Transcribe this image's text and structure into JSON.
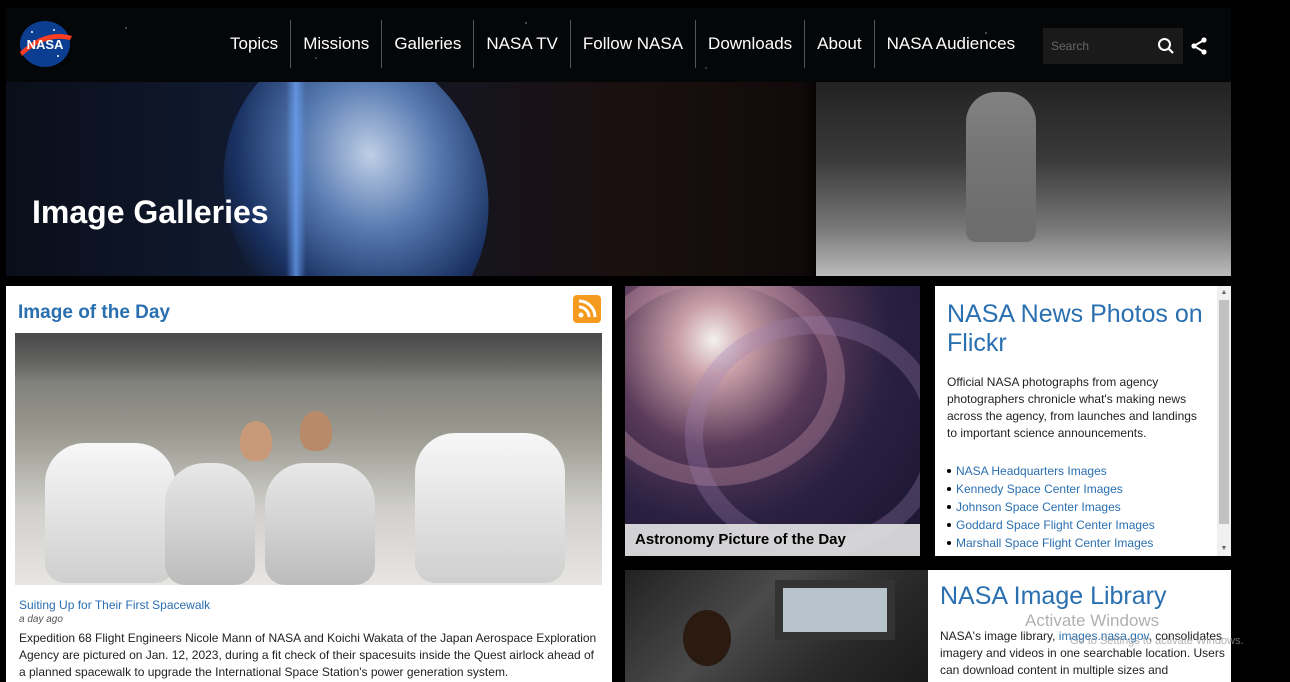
{
  "nav": {
    "items": [
      "Topics",
      "Missions",
      "Galleries",
      "NASA TV",
      "Follow NASA",
      "Downloads",
      "About",
      "NASA Audiences"
    ],
    "search_placeholder": "Search"
  },
  "hero": {
    "title": "Image Galleries"
  },
  "image_of_the_day": {
    "heading": "Image of the Day",
    "caption_title": "Suiting Up for Their First Spacewalk",
    "time_ago": "a day ago",
    "description": "Expedition 68 Flight Engineers Nicole Mann of NASA and Koichi Wakata of the Japan Aerospace Exploration Agency are pictured on Jan. 12, 2023, during a fit check of their spacesuits inside the Quest airlock ahead of a planned spacewalk to upgrade the International Space Station's power generation system."
  },
  "apod": {
    "label": "Astronomy Picture of the Day"
  },
  "flickr": {
    "title": "NASA News Photos on Flickr",
    "description": "Official NASA photographs from agency photographers chronicle what's making news across the agency, from launches and landings to important science announcements.",
    "links": [
      "NASA Headquarters Images",
      "Kennedy Space Center Images",
      "Johnson Space Center Images",
      "Goddard Space Flight Center Images",
      "Marshall Space Flight Center Images"
    ]
  },
  "library": {
    "title": "NASA Image Library",
    "desc_before": "NASA's image library, ",
    "desc_link": "images.nasa.gov",
    "desc_after": ", consolidates imagery and videos in one searchable location. Users can download content in multiple sizes and"
  },
  "watermark": {
    "line1": "Activate Windows",
    "line2": "Go to Settings to activate Windows."
  },
  "colors": {
    "link_blue": "#2a6fb0",
    "rss_orange": "#f39a1f",
    "nasa_blue": "#0b3d91",
    "nasa_red": "#fc3d21"
  }
}
